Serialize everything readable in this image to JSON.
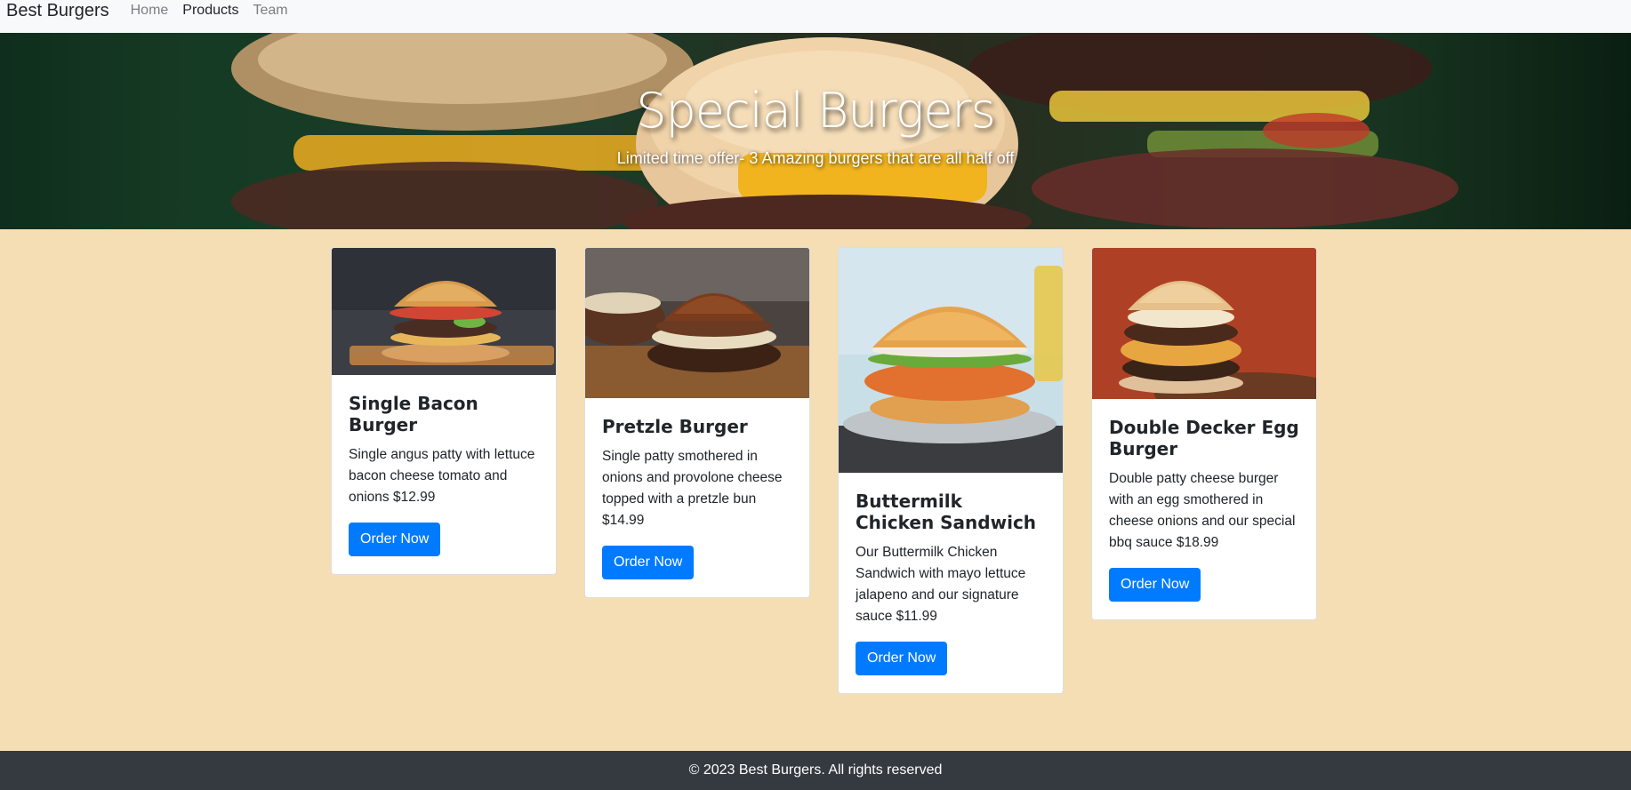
{
  "nav": {
    "brand": "Best Burgers",
    "links": [
      {
        "label": "Home"
      },
      {
        "label": "Products"
      },
      {
        "label": "Team"
      }
    ]
  },
  "hero": {
    "title": "Special Burgers",
    "subtitle": "Limited time offer- 3 Amazing burgers that are all half off"
  },
  "products": [
    {
      "title": "Single Bacon Burger",
      "text": "Single angus patty with lettuce bacon cheese tomato and onions $12.99",
      "button": "Order Now"
    },
    {
      "title": "Pretzle Burger",
      "text": "Single patty smothered in onions and provolone cheese topped with a pretzle bun $14.99",
      "button": "Order Now"
    },
    {
      "title": "Buttermilk Chicken Sandwich",
      "text": "Our Buttermilk Chicken Sandwich with mayo lettuce jalapeno and our signature sauce $11.99",
      "button": "Order Now"
    },
    {
      "title": "Double Decker Egg Burger",
      "text": "Double patty cheese burger with an egg smothered in cheese onions and our special bbq sauce $18.99",
      "button": "Order Now"
    }
  ],
  "footer": {
    "text": "© 2023 Best Burgers. All rights reserved"
  },
  "colors": {
    "page_background": "#f5deb3",
    "navbar_background": "#f8f9fa",
    "button": "#007bff",
    "footer_background": "#343a40"
  }
}
